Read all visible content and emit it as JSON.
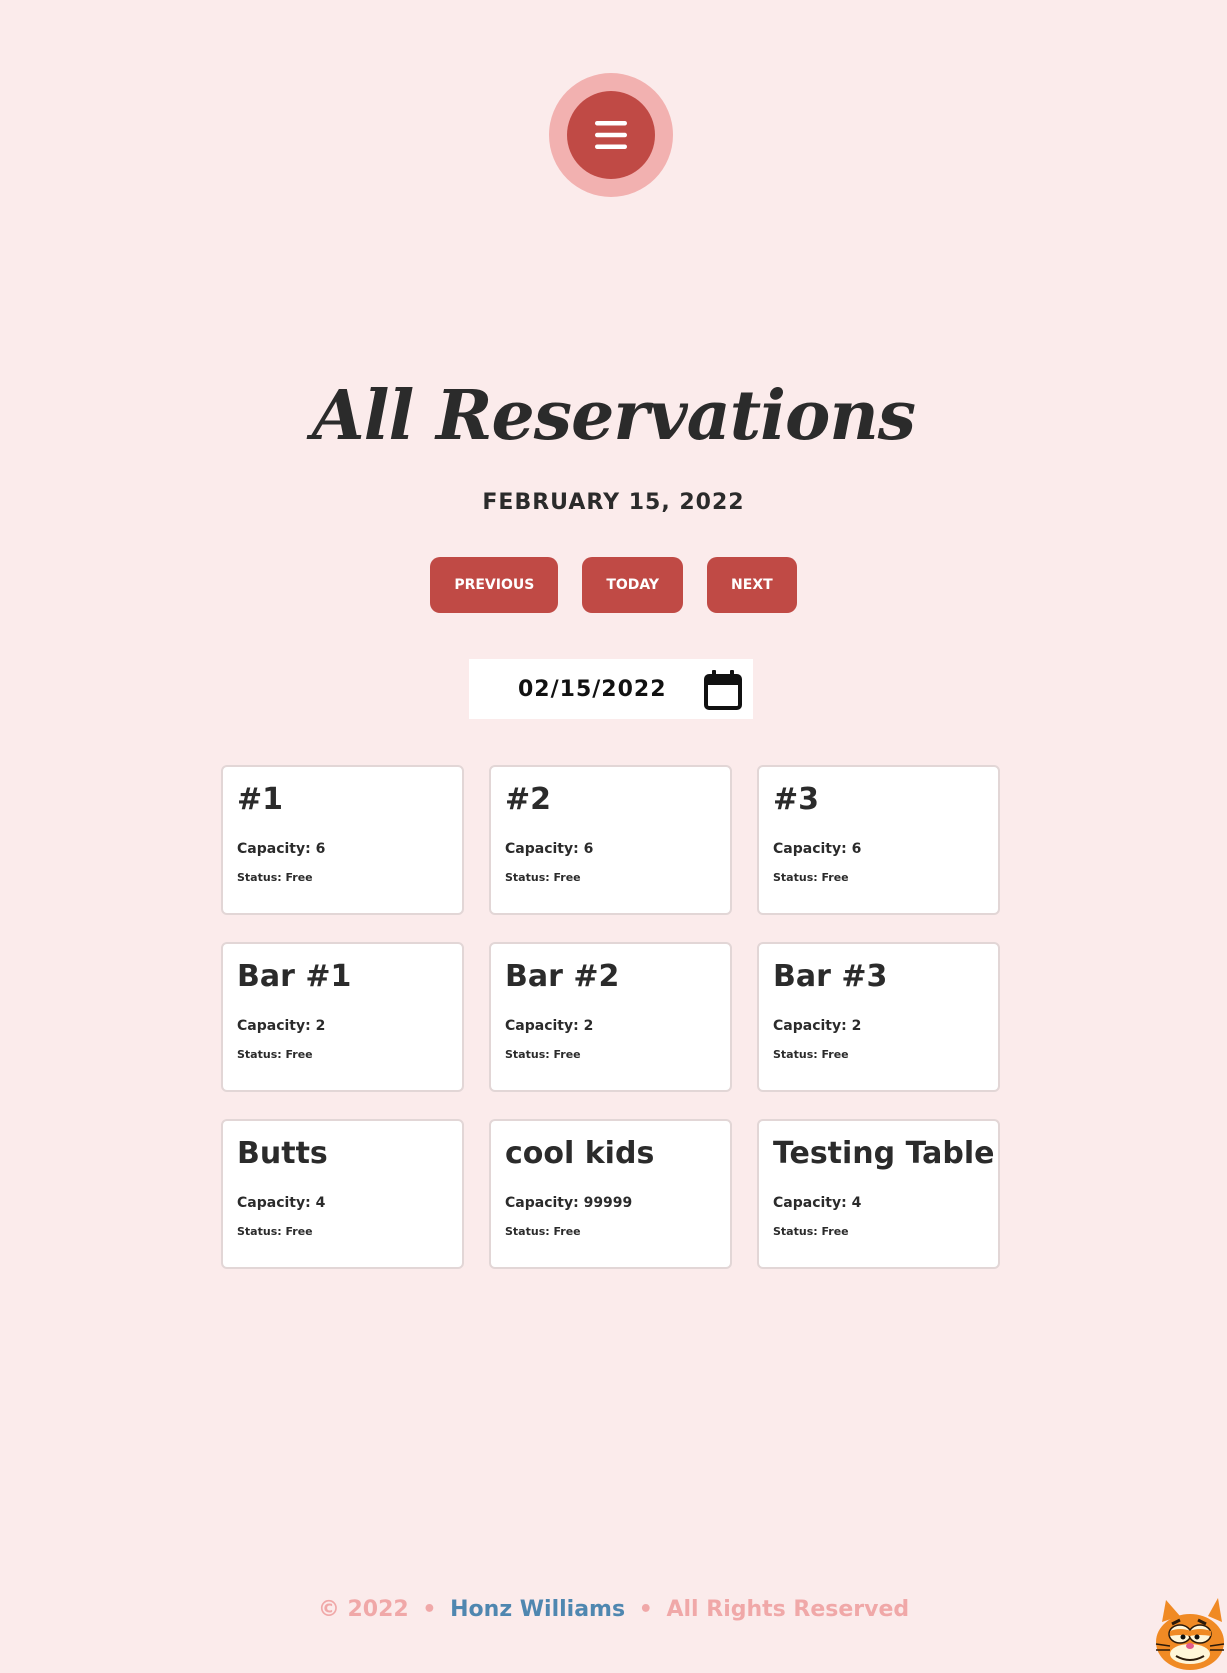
{
  "header": {
    "menu_icon": "hamburger-icon"
  },
  "page": {
    "title": "All Reservations",
    "date_heading": "FEBRUARY 15, 2022"
  },
  "navigation": {
    "previous_label": "PREVIOUS",
    "today_label": "TODAY",
    "next_label": "NEXT"
  },
  "date_picker": {
    "value": "02/15/2022",
    "icon": "calendar-icon"
  },
  "tables": [
    {
      "name": "#1",
      "capacity": "Capacity: 6",
      "status": "Status: Free"
    },
    {
      "name": "#2",
      "capacity": "Capacity: 6",
      "status": "Status: Free"
    },
    {
      "name": "#3",
      "capacity": "Capacity: 6",
      "status": "Status: Free"
    },
    {
      "name": "Bar #1",
      "capacity": "Capacity: 2",
      "status": "Status: Free"
    },
    {
      "name": "Bar #2",
      "capacity": "Capacity: 2",
      "status": "Status: Free"
    },
    {
      "name": "Bar #3",
      "capacity": "Capacity: 2",
      "status": "Status: Free"
    },
    {
      "name": "Butts",
      "capacity": "Capacity: 4",
      "status": "Status: Free"
    },
    {
      "name": "cool kids",
      "capacity": "Capacity: 99999",
      "status": "Status: Free"
    },
    {
      "name": "Testing Table",
      "capacity": "Capacity: 4",
      "status": "Status: Free"
    }
  ],
  "footer": {
    "copyright": "© 2022",
    "separator": "•",
    "author": "Honz Williams",
    "rights": "All Rights Reserved"
  },
  "colors": {
    "background": "#fbebeb",
    "accent": "#c04a45",
    "accent_light": "#f2b1b0",
    "footer_text": "#f0a8a8",
    "author_link": "#4f87b0"
  }
}
